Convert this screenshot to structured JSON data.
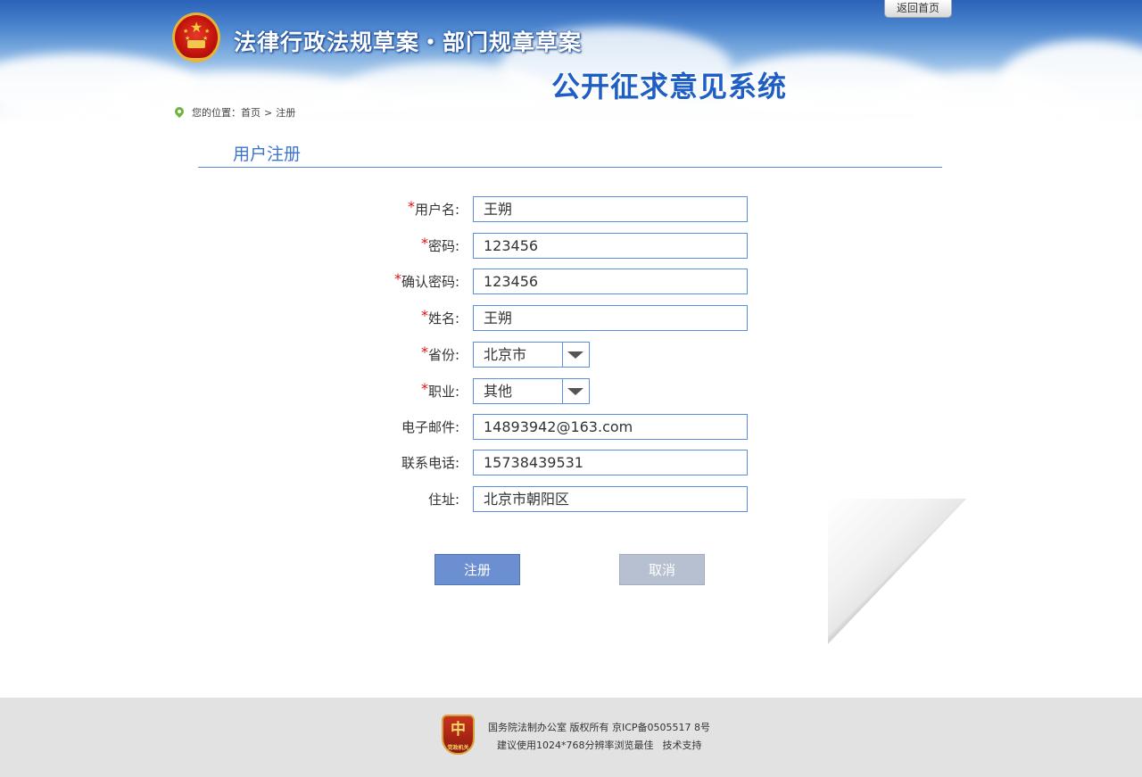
{
  "header": {
    "title_line1": "法律行政法规草案・部门规章草案",
    "title_line2": "公开征求意见系统",
    "home_button": "返回首页"
  },
  "breadcrumb": {
    "prefix": "您的位置：",
    "home": "首页",
    "separator": ">",
    "current": "注册"
  },
  "form": {
    "title": "用户注册",
    "required_mark": "*",
    "fields": [
      {
        "label": "用户名:",
        "value": "王朔",
        "required": true
      },
      {
        "label": "密码:",
        "value": "123456",
        "required": true
      },
      {
        "label": "确认密码:",
        "value": "123456",
        "required": true
      },
      {
        "label": "姓名:",
        "value": "王朔",
        "required": true
      },
      {
        "label": "省份:",
        "value": "北京市",
        "required": true
      },
      {
        "label": "职业:",
        "value": "其他",
        "required": true
      },
      {
        "label": "电子邮件:",
        "value": "14893942@163.com",
        "required": false
      },
      {
        "label": "联系电话:",
        "value": "15738439531",
        "required": false
      },
      {
        "label": "住址:",
        "value": "北京市朝阳区",
        "required": false
      }
    ],
    "submit_label": "注册",
    "cancel_label": "取消"
  },
  "footer": {
    "badge_text": "中",
    "badge_caption": "党政机关",
    "line1": "国务院法制办公室 版权所有 京ICP备0505517 8号",
    "line2_a": "建议使用1024*768分辨率浏览最佳",
    "line2_b": "技术支持"
  },
  "colors": {
    "accent": "#3d74cc",
    "input_border": "#5b8edc",
    "submit_bg": "#6b8fd0",
    "cancel_bg": "#b7c0d0",
    "required": "#e01010"
  }
}
